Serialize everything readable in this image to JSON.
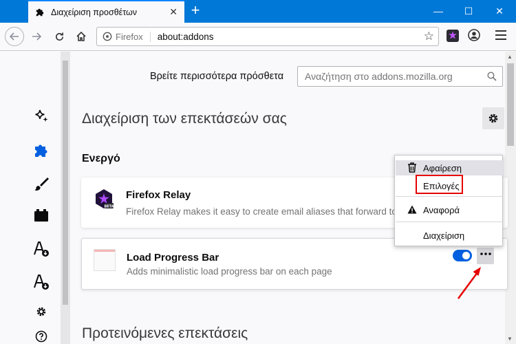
{
  "window": {
    "tab_title": "Διαχείριση προσθέτων",
    "tab_close": "✕",
    "new_tab": "+",
    "minimize": "—",
    "maximize": "☐",
    "close": "✕",
    "titlebar_color": "#0078d7"
  },
  "toolbar": {
    "identity_label": "Firefox",
    "url": "about:addons"
  },
  "sidebar": {
    "items": [
      {
        "name": "recommendations",
        "icon": "sparkle-icon"
      },
      {
        "name": "extensions",
        "icon": "puzzle-icon",
        "selected": true
      },
      {
        "name": "themes",
        "icon": "brush-icon"
      },
      {
        "name": "plugins",
        "icon": "plugin-icon"
      },
      {
        "name": "languages",
        "icon": "language-icon"
      },
      {
        "name": "dictionaries",
        "icon": "dictionary-icon"
      },
      {
        "name": "settings",
        "icon": "gear-icon"
      },
      {
        "name": "support",
        "icon": "help-icon"
      }
    ]
  },
  "header": {
    "find_more_label": "Βρείτε περισσότερα πρόσθετα",
    "search_placeholder": "Αναζήτηση στο addons.mozilla.org"
  },
  "main": {
    "title": "Διαχείριση των επεκτάσεών σας",
    "section_enabled": "Ενεργό",
    "section_recommended": "Προτεινόμενες επεκτάσεις",
    "accent_color": "#0060df"
  },
  "extensions": [
    {
      "name": "Firefox Relay",
      "description": "Firefox Relay makes it easy to create email aliases that forward to",
      "icon": "firefox-relay-icon",
      "badge": "BETA"
    },
    {
      "name": "Load Progress Bar",
      "description": "Adds minimalistic load progress bar on each page",
      "icon": "progress-bar-icon",
      "enabled": true
    }
  ],
  "context_menu": {
    "remove": "Αφαίρεση",
    "options": "Επιλογές",
    "report": "Αναφορά",
    "manage": "Διαχείριση"
  }
}
